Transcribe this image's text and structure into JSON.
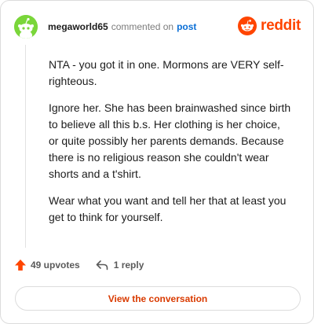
{
  "comment": {
    "username": "megaworld65",
    "action_text": "commented on",
    "post_link_text": "post",
    "paragraphs": [
      "NTA - you got it in one. Mormons are VERY self-righteous.",
      "Ignore her. She has been brainwashed since birth to believe all this b.s. Her clothing is her choice, or quite possibly her parents demands. Because there is no religious reason she couldn't wear shorts and a t'shirt.",
      "Wear what you want and tell her that at least you get to think for yourself."
    ]
  },
  "brand": {
    "name": "reddit",
    "color": "#ff4500",
    "icon": "reddit-logo-icon"
  },
  "stats": {
    "upvotes": "49 upvotes",
    "replies": "1 reply"
  },
  "actions": {
    "view_conversation": "View the conversation"
  },
  "colors": {
    "avatar_bg": "#7ad63a",
    "link": "#0b6fd6",
    "accent": "#d93a00"
  }
}
